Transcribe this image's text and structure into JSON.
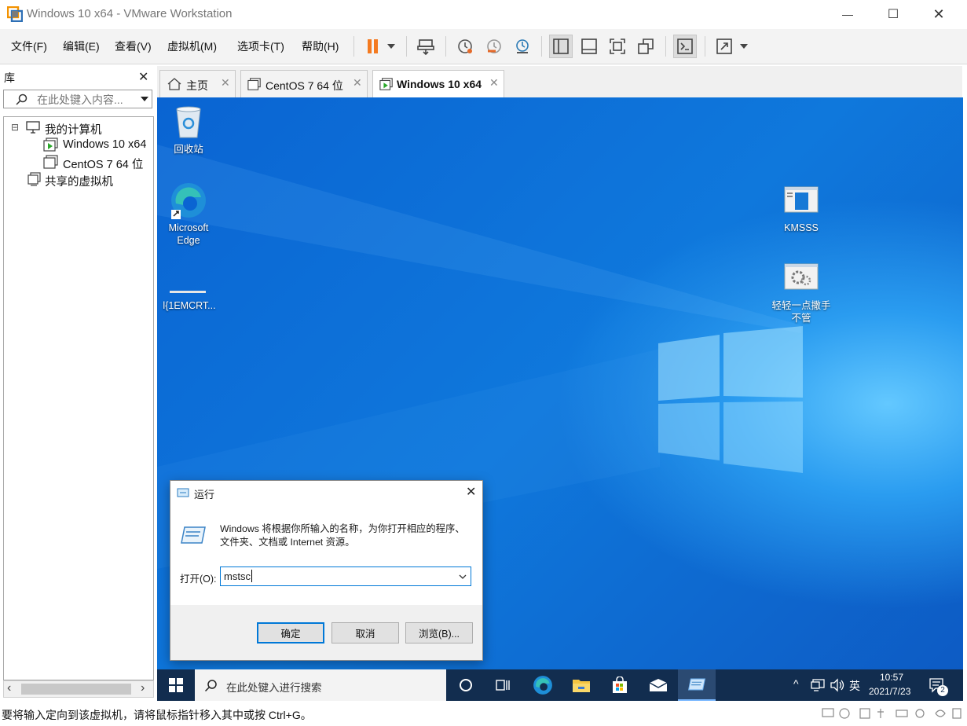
{
  "window": {
    "title": "Windows 10 x64 - VMware Workstation",
    "controls": {
      "minimize": "—",
      "maximize": "☐",
      "close": "✕"
    }
  },
  "menu": [
    "文件(F)",
    "编辑(E)",
    "查看(V)",
    "虚拟机(M)",
    "选项卡(T)",
    "帮助(H)"
  ],
  "library": {
    "title": "库",
    "close": "✕",
    "search_placeholder": "在此处键入内容...",
    "tree": {
      "collapse_glyph": "⊟",
      "root": "我的计算机",
      "vms": [
        "Windows 10 x64",
        "CentOS 7 64 位"
      ],
      "shared": "共享的虚拟机"
    },
    "scroll_left": "‹",
    "scroll_right": "›"
  },
  "tabs": [
    {
      "label": "主页",
      "close": "✕"
    },
    {
      "label": "CentOS 7 64 位",
      "close": "✕"
    },
    {
      "label": "Windows 10 x64",
      "close": "✕"
    }
  ],
  "desktop": {
    "icons": [
      {
        "label": "回收站"
      },
      {
        "label": "Microsoft Edge"
      },
      {
        "label": "l{1EMCRT..."
      },
      {
        "label": "KMSSS"
      },
      {
        "label": "轻轻一点撒手不管"
      }
    ]
  },
  "run_dialog": {
    "title": "运行",
    "close": "✕",
    "description": "Windows 将根据你所输入的名称，为你打开相应的程序、文件夹、文档或 Internet 资源。",
    "open_label": "打开(O):",
    "input_value": "mstsc",
    "ok": "确定",
    "cancel": "取消",
    "browse": "浏览(B)..."
  },
  "taskbar": {
    "search_placeholder": "在此处键入进行搜索",
    "ime": "英",
    "time": "10:57",
    "date": "2021/7/23",
    "notification_count": "2",
    "tray_up": "^"
  },
  "status": "要将输入定向到该虚拟机，请将鼠标指针移入其中或按 Ctrl+G。",
  "colors": {
    "accent_pause": "#f47a20",
    "desktop_blue": "#0f78dc",
    "taskbar": "#122d4f"
  }
}
